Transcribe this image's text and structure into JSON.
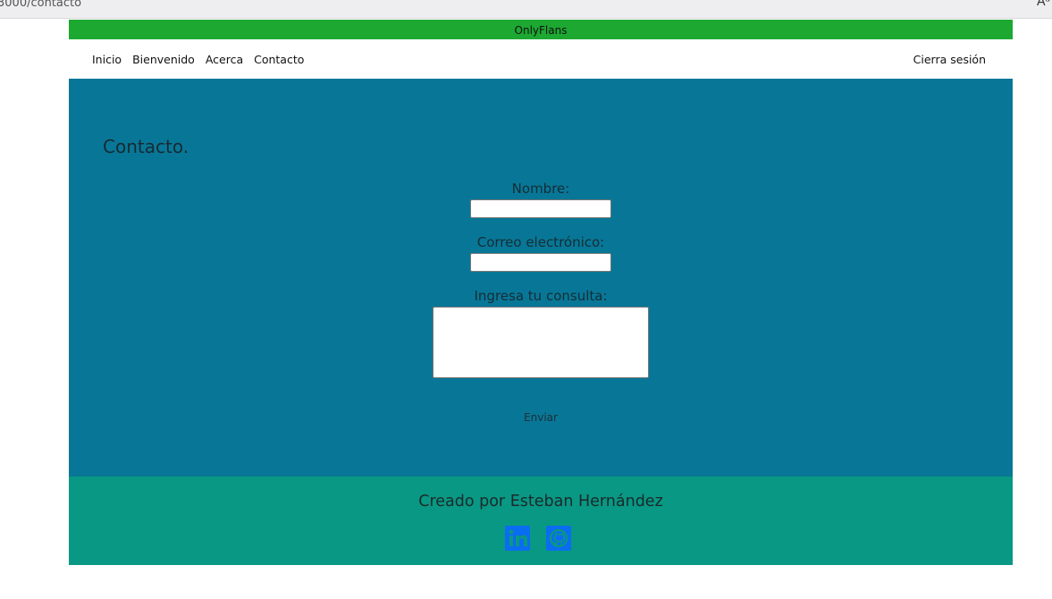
{
  "browser": {
    "url": "3000/contacto"
  },
  "topbar": {
    "brand": "OnlyFlans"
  },
  "nav": {
    "links": [
      "Inicio",
      "Bienvenido",
      "Acerca",
      "Contacto"
    ],
    "logout": "Cierra sesión"
  },
  "main": {
    "title": "Contacto.",
    "form": {
      "name_label": "Nombre:",
      "name_value": "",
      "email_label": "Correo electrónico:",
      "email_value": "",
      "query_label": "Ingresa tu consulta:",
      "query_value": "",
      "submit_label": "Enviar"
    }
  },
  "footer": {
    "text": "Creado por Esteban Hernández",
    "icons": [
      "linkedin-icon",
      "github-icon"
    ]
  },
  "colors": {
    "topbar": "#1ca831",
    "main": "#087797",
    "footer": "#099883",
    "social_icon": "#0a6cf0"
  }
}
